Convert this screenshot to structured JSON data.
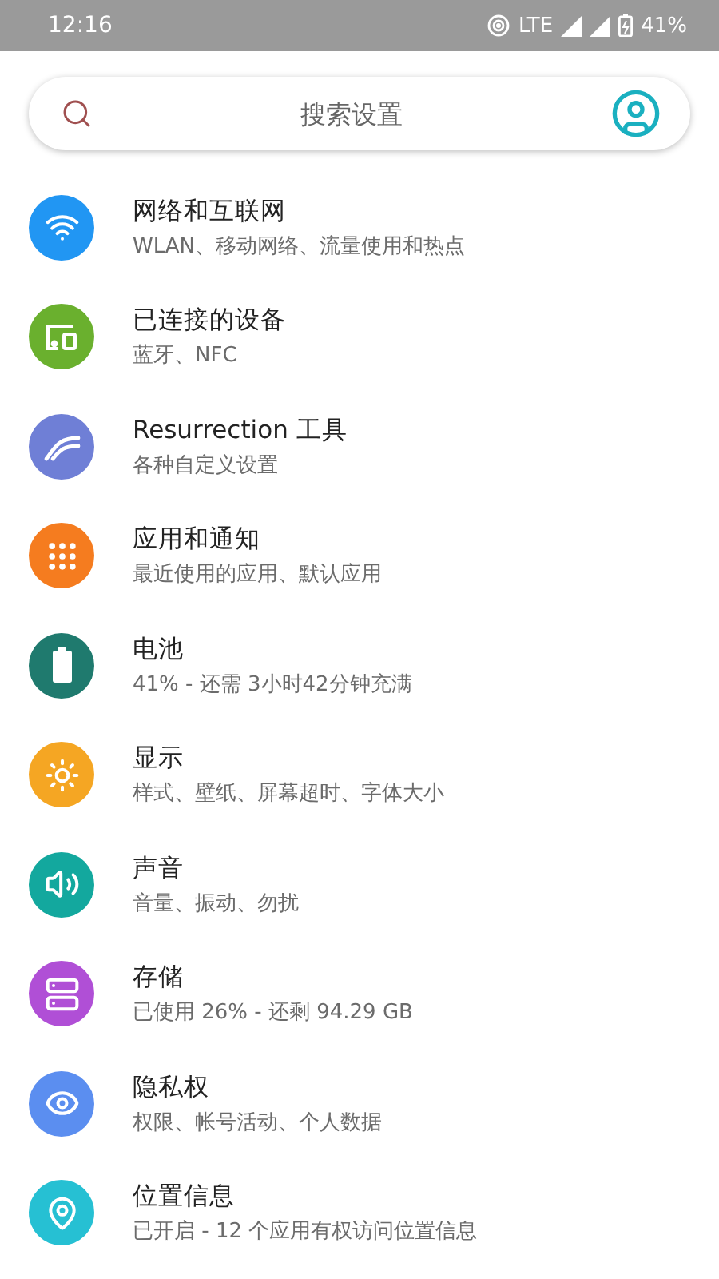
{
  "status_bar": {
    "time": "12:16",
    "network": "LTE",
    "battery": "41%"
  },
  "search": {
    "placeholder": "搜索设置"
  },
  "items": [
    {
      "color": "#2196f3",
      "title": "网络和互联网",
      "subtitle": "WLAN、移动网络、流量使用和热点"
    },
    {
      "color": "#6ab02e",
      "title": "已连接的设备",
      "subtitle": "蓝牙、NFC"
    },
    {
      "color": "#6f7fd6",
      "title": "Resurrection 工具",
      "subtitle": "各种自定义设置"
    },
    {
      "color": "#f57c1f",
      "title": "应用和通知",
      "subtitle": "最近使用的应用、默认应用"
    },
    {
      "color": "#1f7a6e",
      "title": "电池",
      "subtitle": "41% - 还需 3小时42分钟充满"
    },
    {
      "color": "#f5a623",
      "title": "显示",
      "subtitle": "样式、壁纸、屏幕超时、字体大小"
    },
    {
      "color": "#13a89e",
      "title": "声音",
      "subtitle": "音量、振动、勿扰"
    },
    {
      "color": "#b04fd6",
      "title": "存储",
      "subtitle": "已使用 26% - 还剩 94.29 GB"
    },
    {
      "color": "#5b8ef0",
      "title": "隐私权",
      "subtitle": "权限、帐号活动、个人数据"
    },
    {
      "color": "#26c0d3",
      "title": "位置信息",
      "subtitle": "已开启 - 12 个应用有权访问位置信息"
    }
  ]
}
